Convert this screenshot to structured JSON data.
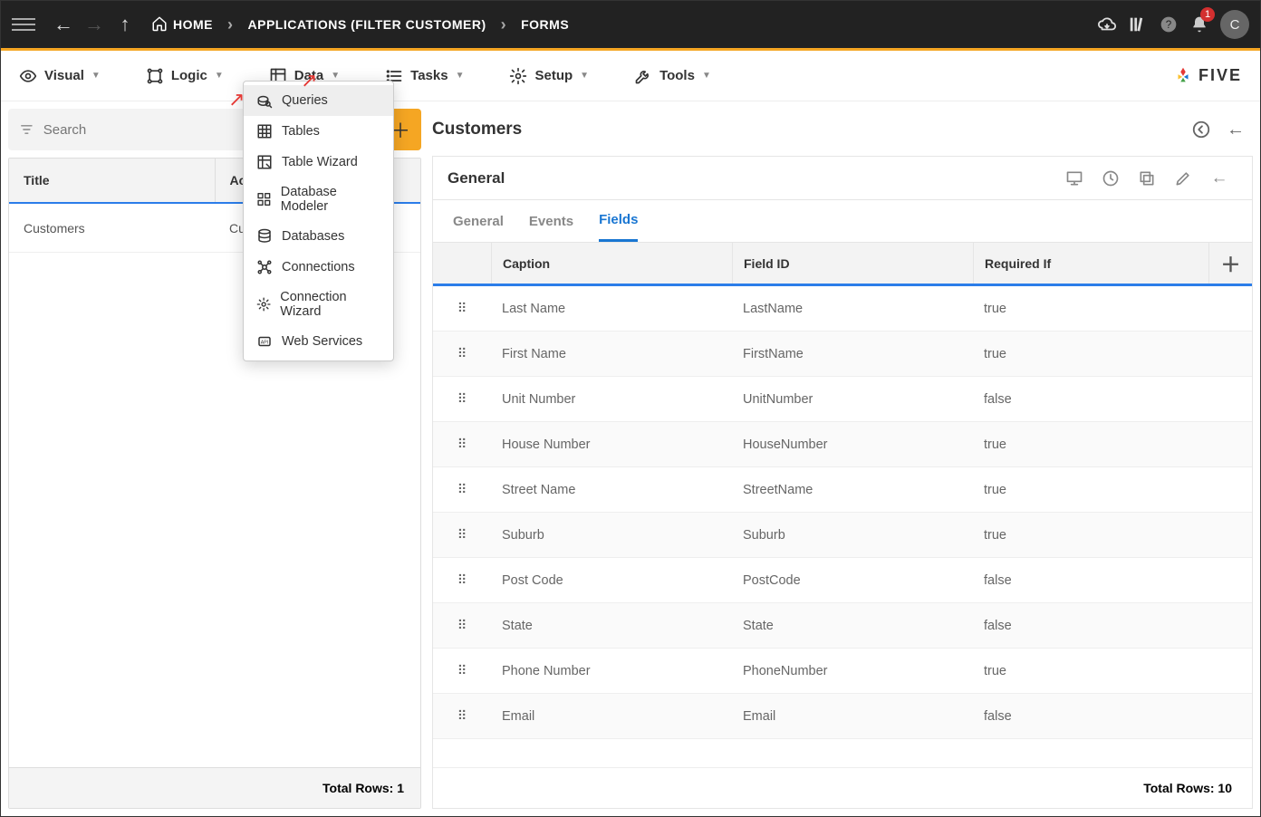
{
  "topbar": {
    "home_label": "HOME",
    "crumb1": "APPLICATIONS (FILTER CUSTOMER)",
    "crumb2": "FORMS",
    "notif_count": "1",
    "avatar_letter": "C"
  },
  "menubar": {
    "items": [
      {
        "label": "Visual"
      },
      {
        "label": "Logic"
      },
      {
        "label": "Data"
      },
      {
        "label": "Tasks"
      },
      {
        "label": "Setup"
      },
      {
        "label": "Tools"
      }
    ],
    "brand": "FIVE"
  },
  "dropdown": {
    "items": [
      {
        "label": "Queries"
      },
      {
        "label": "Tables"
      },
      {
        "label": "Table Wizard"
      },
      {
        "label": "Database Modeler"
      },
      {
        "label": "Databases"
      },
      {
        "label": "Connections"
      },
      {
        "label": "Connection Wizard"
      },
      {
        "label": "Web Services"
      }
    ]
  },
  "search": {
    "placeholder": "Search"
  },
  "left_table": {
    "headers": {
      "title": "Title",
      "action": "Action"
    },
    "rows": [
      {
        "title": "Customers",
        "action": "Customers"
      }
    ],
    "footer": "Total Rows: 1"
  },
  "right": {
    "title": "Customers",
    "subtitle": "General",
    "tabs": {
      "general": "General",
      "events": "Events",
      "fields": "Fields"
    },
    "field_headers": {
      "caption": "Caption",
      "field_id": "Field ID",
      "required": "Required If"
    },
    "fields": [
      {
        "caption": "Last Name",
        "field_id": "LastName",
        "required": "true"
      },
      {
        "caption": "First Name",
        "field_id": "FirstName",
        "required": "true"
      },
      {
        "caption": "Unit Number",
        "field_id": "UnitNumber",
        "required": "false"
      },
      {
        "caption": "House Number",
        "field_id": "HouseNumber",
        "required": "true"
      },
      {
        "caption": "Street Name",
        "field_id": "StreetName",
        "required": "true"
      },
      {
        "caption": "Suburb",
        "field_id": "Suburb",
        "required": "true"
      },
      {
        "caption": "Post Code",
        "field_id": "PostCode",
        "required": "false"
      },
      {
        "caption": "State",
        "field_id": "State",
        "required": "false"
      },
      {
        "caption": "Phone Number",
        "field_id": "PhoneNumber",
        "required": "true"
      },
      {
        "caption": "Email",
        "field_id": "Email",
        "required": "false"
      }
    ],
    "footer": "Total Rows: 10"
  }
}
